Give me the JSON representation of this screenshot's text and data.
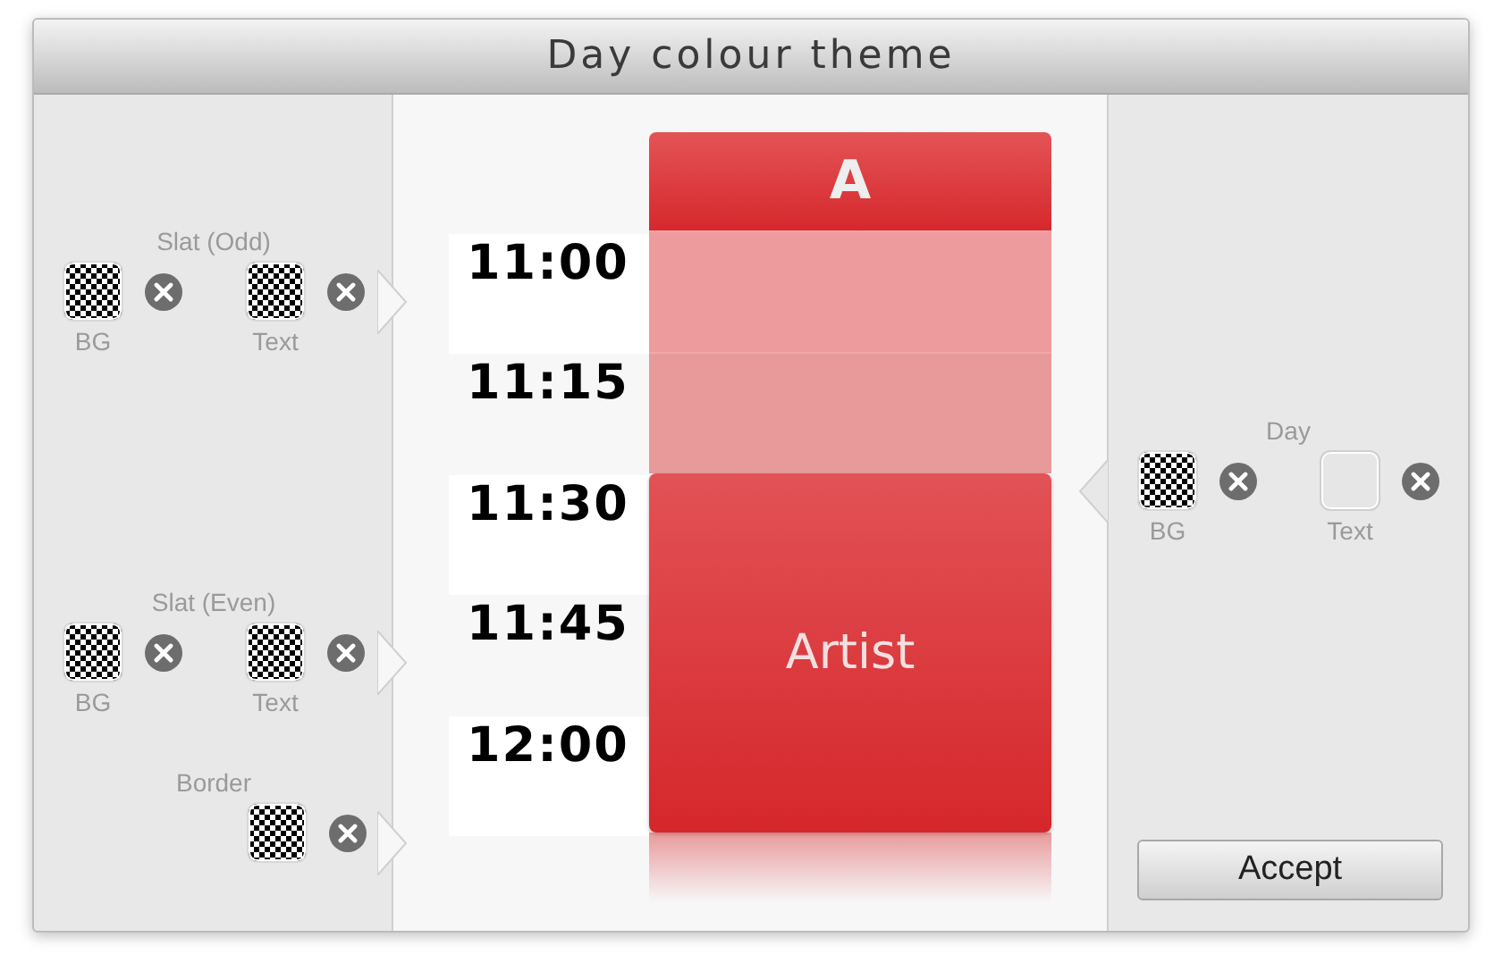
{
  "window": {
    "title": "Day colour theme"
  },
  "left_panel": {
    "groups": [
      {
        "title": "Slat (Odd)",
        "pickers": [
          {
            "label": "BG",
            "kind": "checker"
          },
          {
            "label": "Text",
            "kind": "checker"
          }
        ]
      },
      {
        "title": "Slat (Even)",
        "pickers": [
          {
            "label": "BG",
            "kind": "checker"
          },
          {
            "label": "Text",
            "kind": "checker"
          }
        ]
      },
      {
        "title": "Border",
        "pickers": [
          {
            "kind": "checker"
          }
        ]
      }
    ]
  },
  "preview": {
    "times": [
      {
        "label": "11:00"
      },
      {
        "label": "11:15"
      },
      {
        "label": "11:30"
      },
      {
        "label": "11:45"
      },
      {
        "label": "12:00"
      }
    ],
    "column": {
      "header": "A",
      "event": {
        "title": "Artist"
      }
    }
  },
  "right_panel": {
    "groups": [
      {
        "title": "Day",
        "pickers": [
          {
            "label": "BG",
            "kind": "checker"
          },
          {
            "label": "Text",
            "kind": "empty"
          }
        ]
      }
    ]
  },
  "buttons": [
    "Accept"
  ]
}
